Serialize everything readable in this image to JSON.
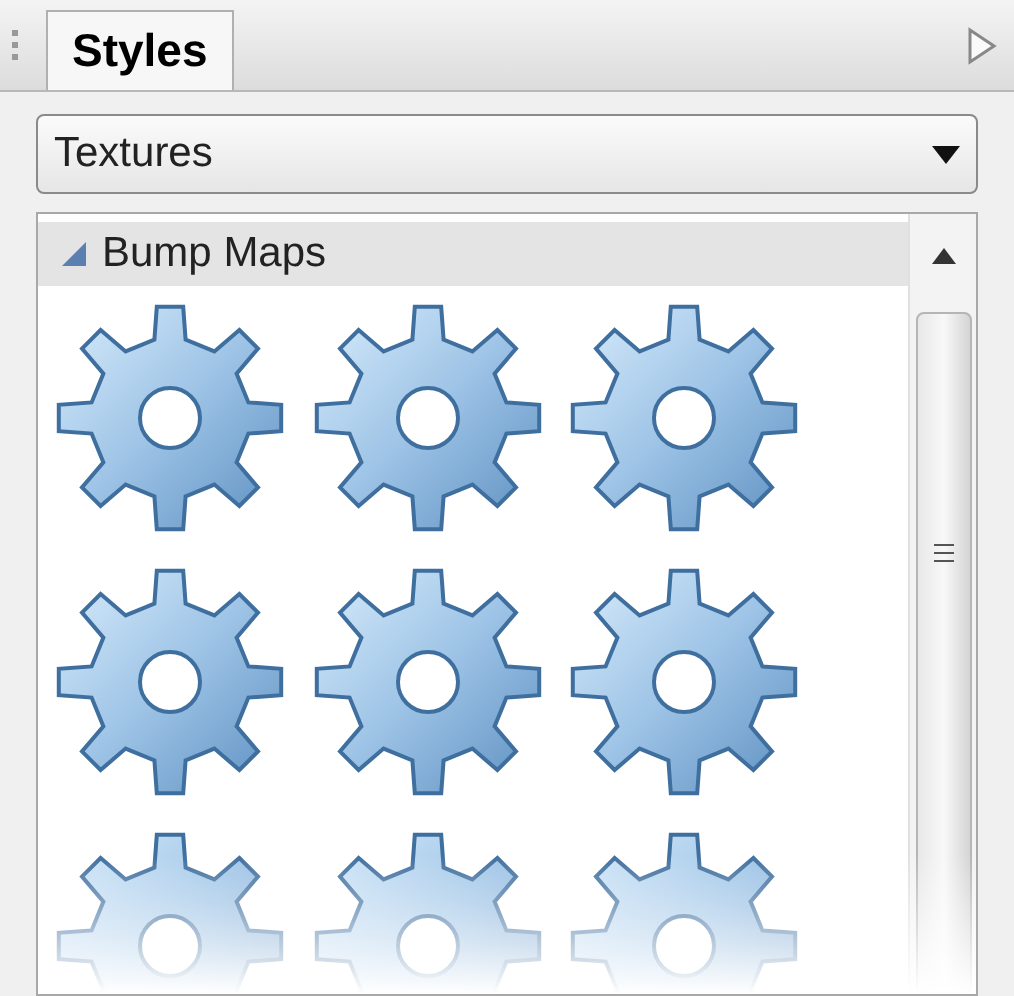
{
  "panel": {
    "tabs": [
      {
        "label": "Styles",
        "selected": true
      }
    ]
  },
  "dropdown": {
    "value": "Textures"
  },
  "section": {
    "title": "Bump Maps",
    "expanded": true
  }
}
